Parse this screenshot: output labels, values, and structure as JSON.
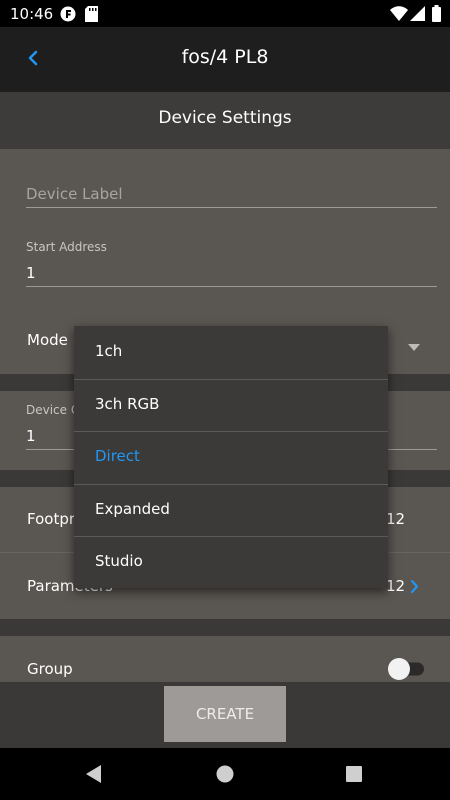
{
  "status_bar": {
    "time": "10:46"
  },
  "app_bar": {
    "title": "fos/4 PL8"
  },
  "section_header": {
    "title": "Device Settings"
  },
  "form": {
    "device_label_placeholder": "Device Label",
    "start_address_label": "Start Address",
    "start_address_value": "1",
    "mode_label": "Mode",
    "device_quantity_label": "Device Q",
    "device_quantity_value": "1",
    "footprint_label": "Footpr",
    "footprint_value": "12",
    "parameters_label": "Parameters",
    "parameters_value": "12",
    "group_label": "Group"
  },
  "mode_dropdown": {
    "options": [
      "1ch",
      "3ch RGB",
      "Direct",
      "Expanded",
      "Studio"
    ],
    "selected": "Direct"
  },
  "actions": {
    "create_label": "CREATE"
  },
  "colors": {
    "accent": "#2196f3",
    "background": "#3b3937",
    "panel": "#5a5652"
  }
}
